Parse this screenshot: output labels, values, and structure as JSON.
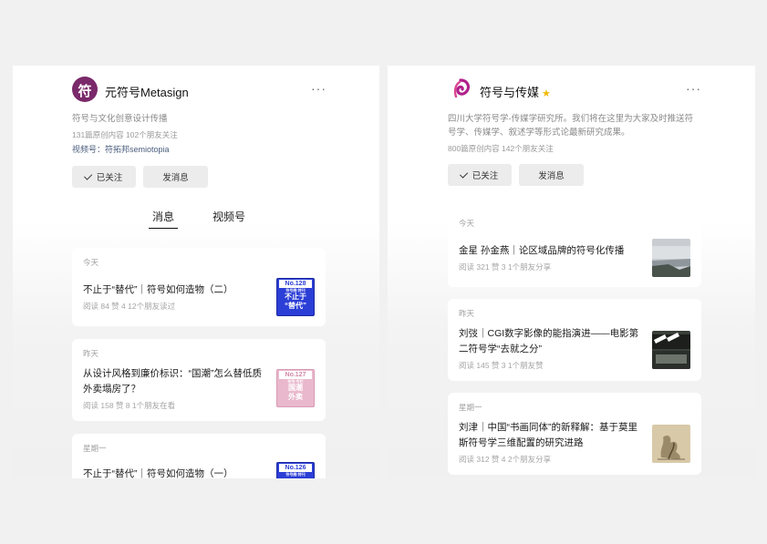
{
  "left": {
    "name": "元符号Metasign",
    "desc": "符号与文化创意设计传播",
    "stats": "131篇原创内容  102个朋友关注",
    "video_label": "视频号：符拓邦semiotopia",
    "follow": "已关注",
    "message": "发消息",
    "tabs": [
      "消息",
      "视频号"
    ],
    "more": "···",
    "avatar_char": "符",
    "cards": [
      {
        "day": "今天",
        "title": "不止于“替代”｜符号如何造物（二）",
        "meta": "阅读 84  赞 4  12个朋友读过",
        "badge": {
          "no": "No.128",
          "sub": "符号圈·特刊",
          "line1": "不止于",
          "line2": "“替代”"
        }
      },
      {
        "day": "昨天",
        "title": "从设计风格到廉价标识：“国潮”怎么替低质外卖塌房了？",
        "meta": "阅读 158  赞 8  1个朋友在看",
        "badge": {
          "no": "No.127",
          "sub": "符号·专栏",
          "line1": "国潮",
          "line2": "外卖"
        }
      },
      {
        "day": "星期一",
        "title": "不止于“替代”｜符号如何造物（一）",
        "meta": "",
        "badge": {
          "no": "No.126",
          "sub": "符号圈·特刊",
          "line1": "",
          "line2": ""
        }
      }
    ]
  },
  "right": {
    "name": "符号与传媒",
    "star": "★",
    "desc": "四川大学符号学-传媒学研究所。我们将在这里为大家及时推送符号学、传媒学、叙述学等形式论最新研究成果。",
    "stats": "800篇原创内容  142个朋友关注",
    "follow": "已关注",
    "message": "发消息",
    "more": "···",
    "cards": [
      {
        "day": "今天",
        "title": "金星 孙金燕｜论区域品牌的符号化传播",
        "meta": "阅读 321  赞 3  1个朋友分享"
      },
      {
        "day": "昨天",
        "title": "刘弢｜CGI数字影像的能指演进——电影第二符号学“去就之分”",
        "meta": "阅读 145  赞 3  1个朋友赞"
      },
      {
        "day": "星期一",
        "title": "刘津｜中国“书画同体”的新释解：基于莫里斯符号学三维配置的研究进路",
        "meta": "阅读 312  赞 4  2个朋友分享"
      }
    ]
  },
  "colors": {
    "badge_blue": "#2b3ed6",
    "badge_pink": "#e9b8cc",
    "accent_purple": "#7a2a6a"
  }
}
